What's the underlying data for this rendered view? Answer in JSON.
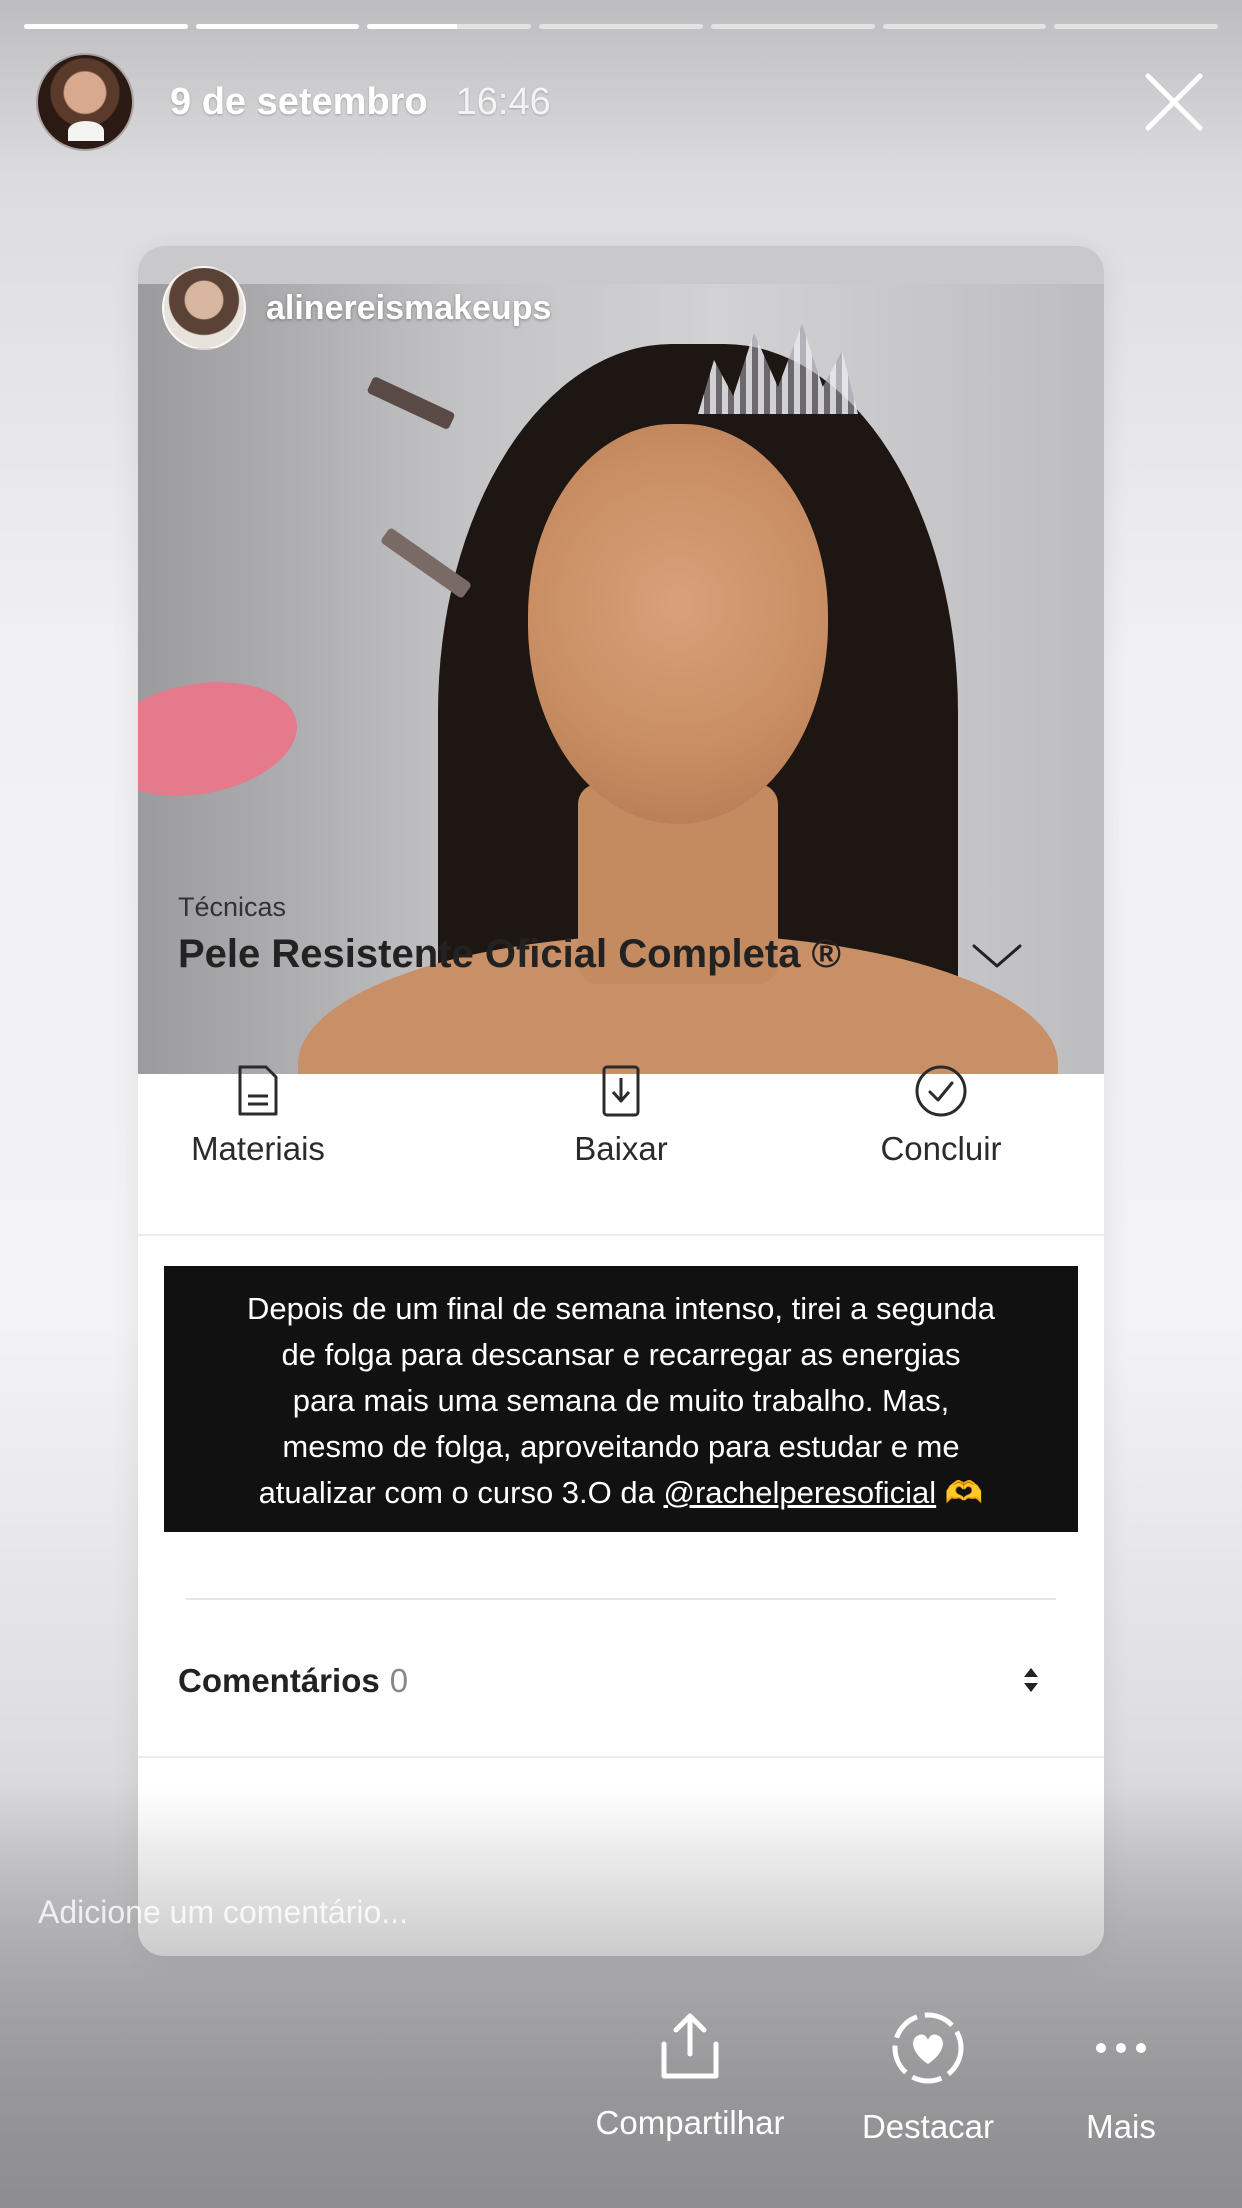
{
  "story": {
    "progress": [
      1,
      1,
      0.55,
      0,
      0,
      0,
      0
    ],
    "date": "9 de setembro",
    "time": "16:46",
    "close_icon": "close-icon"
  },
  "post": {
    "username": "alinereismakeups",
    "category": "Técnicas",
    "title": "Pele Resistente Oficial Completa ®",
    "actions": [
      {
        "label": "Materiais",
        "icon": "document-icon"
      },
      {
        "label": "Baixar",
        "icon": "download-icon"
      },
      {
        "label": "Concluir",
        "icon": "check-circle-icon"
      }
    ],
    "caption_lines": [
      "Depois de um final de semana intenso, tirei a segunda",
      "de folga para descansar e recarregar as energias",
      "para mais uma semana de muito trabalho. Mas,",
      "mesmo de folga, aproveitando para estudar e me"
    ],
    "caption_last_prefix": "atualizar com o curso 3.O da ",
    "caption_mention": "@rachelperesoficial",
    "caption_emoji": "🫶",
    "comments_label": "Comentários",
    "comments_count": "0"
  },
  "footer": {
    "comment_placeholder": "Adicione um comentário...",
    "actions": [
      {
        "label": "Compartilhar",
        "icon": "share-icon"
      },
      {
        "label": "Destacar",
        "icon": "highlight-heart-icon"
      },
      {
        "label": "Mais",
        "icon": "more-dots-icon"
      }
    ]
  },
  "colors": {
    "caption_bg": "#111111",
    "text_dark": "#222222"
  }
}
